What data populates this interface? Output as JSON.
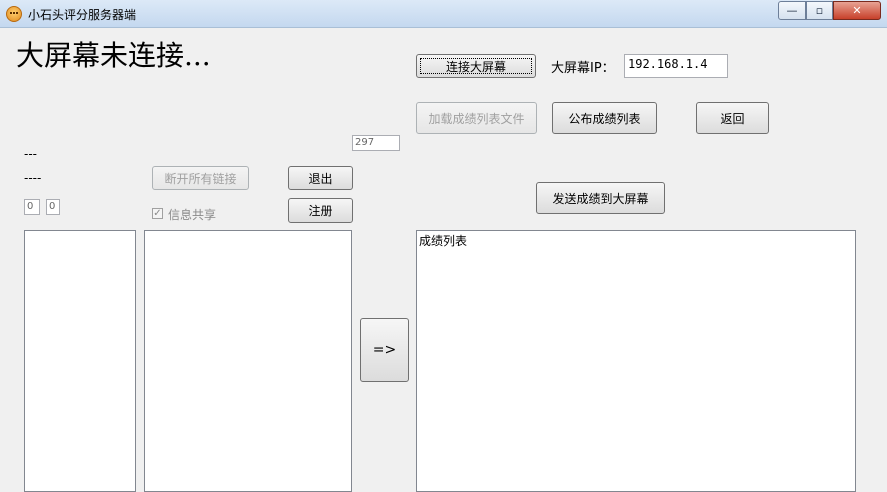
{
  "window": {
    "title": "小石头评分服务器端",
    "min_glyph": "—",
    "max_glyph": "▫",
    "close_glyph": "✕"
  },
  "status_text": "大屏幕未连接...",
  "buttons": {
    "connect": "连接大屏幕",
    "load_file": "加载成绩列表文件",
    "publish": "公布成绩列表",
    "back": "返回",
    "disconnect_all": "断开所有链接",
    "exit": "退出",
    "register": "注册",
    "send_to_screen": "发送成绩到大屏幕",
    "transfer": "=>"
  },
  "ip": {
    "label": "大屏幕IP：",
    "value": "192.168.1.4"
  },
  "counter_value": "297",
  "dash_line_1": "---",
  "dash_line_2": "----",
  "small_field_1": "0",
  "small_field_2": "0",
  "share_checkbox": {
    "label": "信息共享",
    "checked": true,
    "mark": "✓"
  },
  "score_list_header": "成绩列表"
}
